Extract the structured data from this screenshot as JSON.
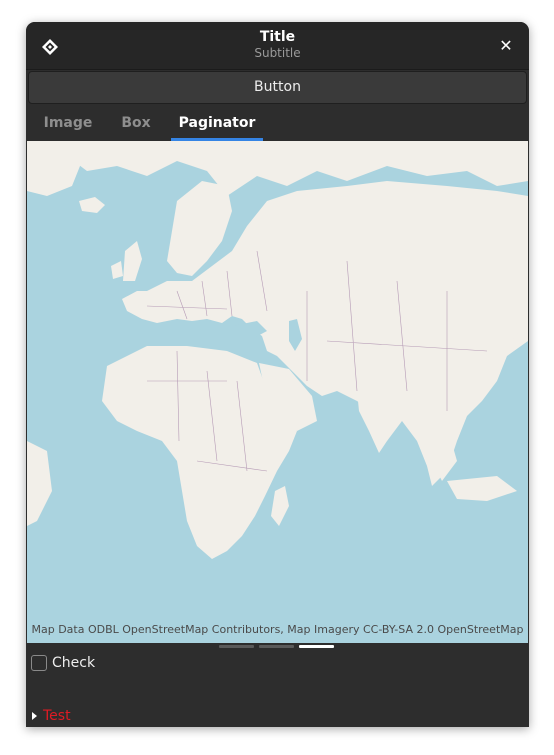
{
  "header": {
    "title": "Title",
    "subtitle": "Subtitle",
    "app_icon": "app-icon",
    "close_icon": "close-icon",
    "close_glyph": "✕"
  },
  "main_button": {
    "label": "Button"
  },
  "tabs": [
    {
      "label": "Image",
      "active": false
    },
    {
      "label": "Box",
      "active": false
    },
    {
      "label": "Paginator",
      "active": true
    }
  ],
  "map": {
    "attribution": "Map Data ODBL OpenStreetMap Contributors, Map Imagery CC-BY-SA 2.0 OpenStreetMap",
    "water_color": "#aad3df",
    "land_color": "#f2efe9",
    "border_color": "#b59ab5"
  },
  "paginator": {
    "pages": 3,
    "current_page": 3
  },
  "check": {
    "label": "Check",
    "checked": false
  },
  "expander": {
    "label": "Test",
    "expanded": false,
    "label_color": "#e01b24"
  },
  "colors": {
    "accent": "#3584e4",
    "headerbar": "#262626",
    "window_bg": "#2d2d2d"
  }
}
